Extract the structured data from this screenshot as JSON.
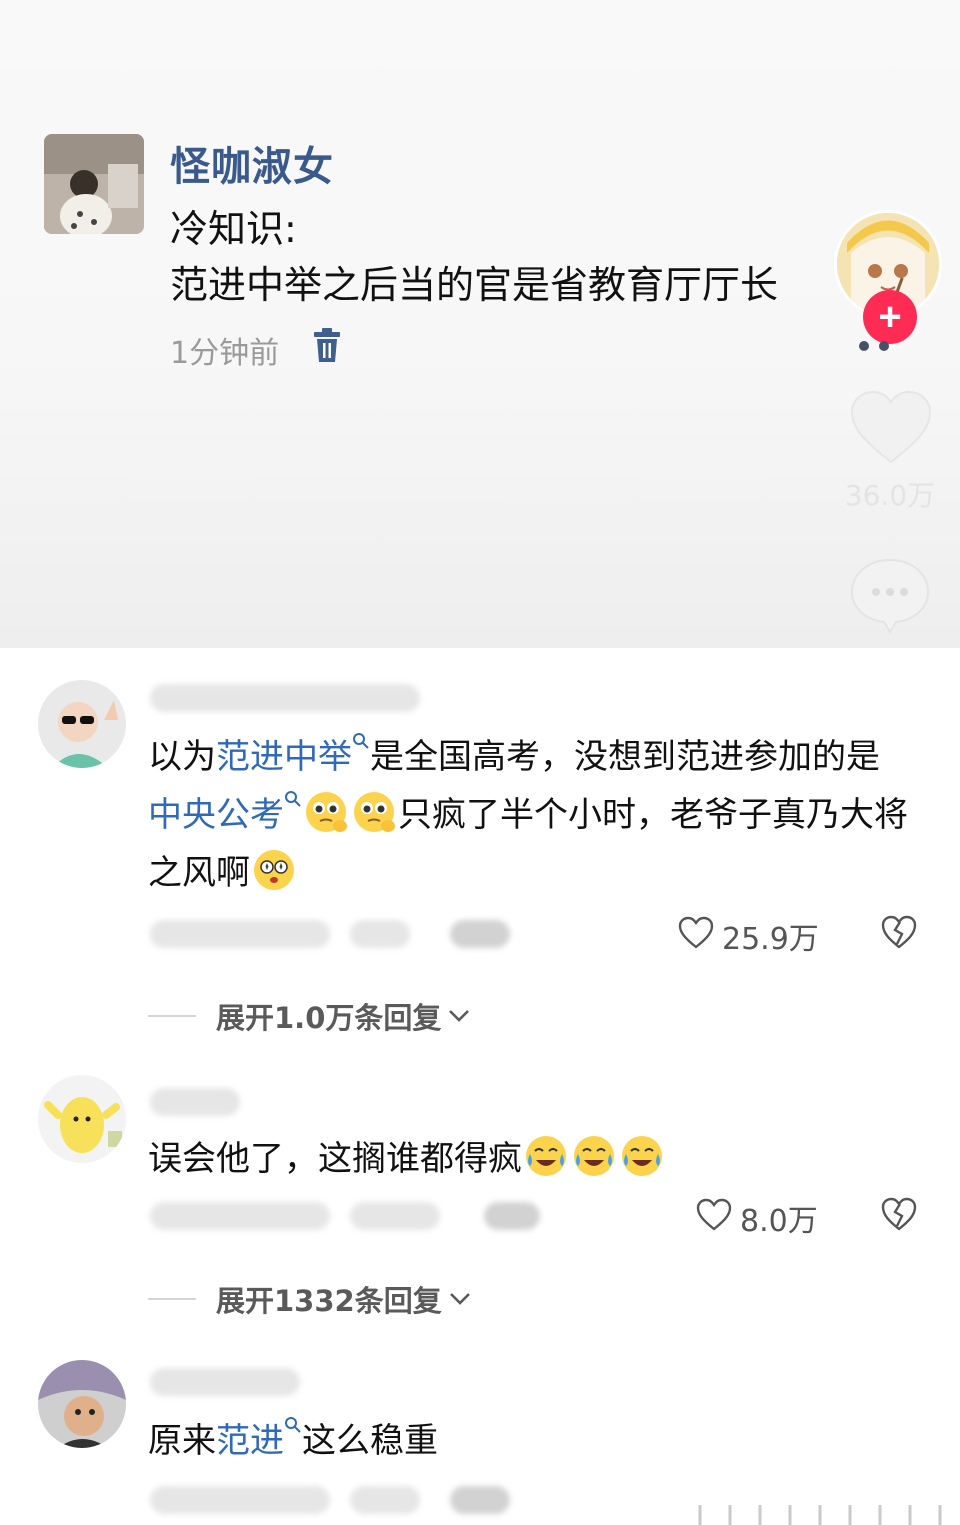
{
  "post": {
    "author": "怪咖淑女",
    "line1": "冷知识:",
    "line2": "范进中举之后当的官是省教育厅厅长",
    "time": "1分钟前"
  },
  "sidebar": {
    "like_count": "36.0万",
    "follow_symbol": "+"
  },
  "comments": [
    {
      "segments": [
        {
          "text": "以为",
          "highlight": false
        },
        {
          "text": "范进中举",
          "highlight": true
        },
        {
          "text": "是全国高考，没想到范进参加的是",
          "highlight": false
        },
        {
          "text": "中央公考",
          "highlight": true
        }
      ],
      "tail": "只疯了半个小时，老爷子真乃大将之风啊",
      "likes": "25.9万",
      "expand": "展开1.0万条回复"
    },
    {
      "text": "误会他了，这搁谁都得疯",
      "likes": "8.0万",
      "expand": "展开1332条回复"
    },
    {
      "prefix": "原来",
      "highlight": "范进",
      "suffix": "这么稳重"
    }
  ],
  "colors": {
    "link": "#2f6ab8",
    "author": "#3b5a8c",
    "follow": "#fe2c55"
  }
}
